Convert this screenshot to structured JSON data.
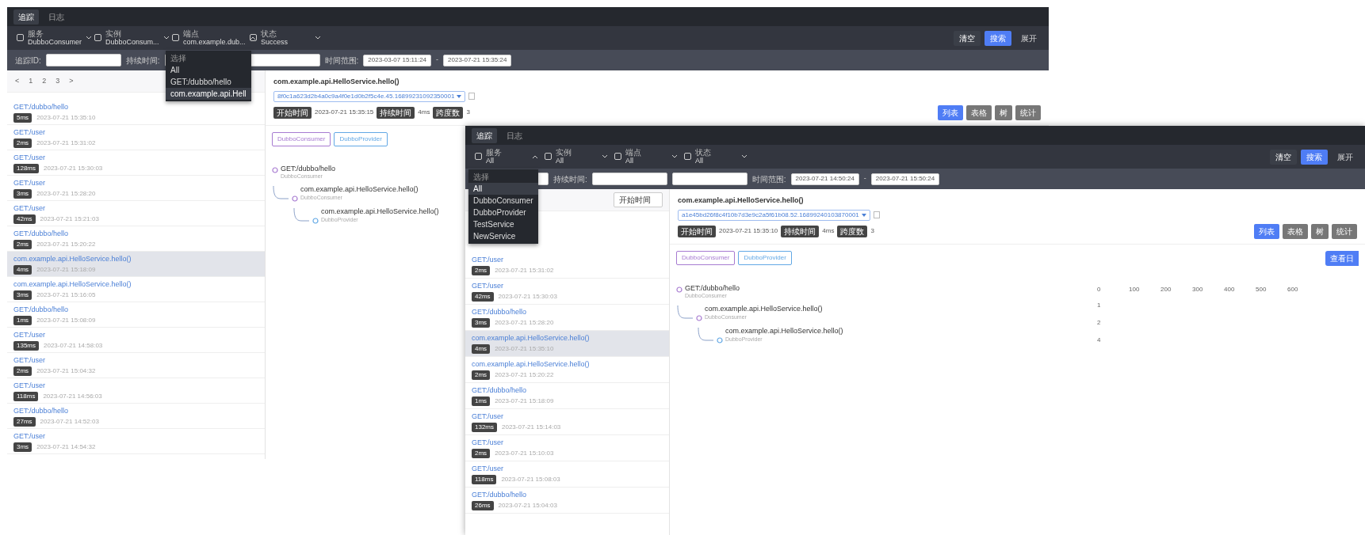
{
  "windows": [
    {
      "kind": "back",
      "tabs": [
        {
          "label": "追踪",
          "selected": true
        },
        {
          "label": "日志",
          "selected": false
        }
      ],
      "filters": [
        {
          "label": "服务",
          "value": "DubboConsumer",
          "open": false
        },
        {
          "label": "实例",
          "value": "DubboConsum...",
          "open": false
        },
        {
          "label": "端点",
          "value": "com.example.dub...",
          "open": true,
          "options": [
            {
              "label": "选择",
              "selected": false
            },
            {
              "label": "All",
              "selected": false
            },
            {
              "label": "GET:/dubbo/hello",
              "selected": false
            },
            {
              "label": "com.example.api.Hell",
              "selected": true
            }
          ]
        },
        {
          "label": "状态",
          "value": "Success",
          "open": false
        }
      ],
      "actions": [
        {
          "label": "清空",
          "kind": "plain"
        },
        {
          "label": "搜索",
          "kind": "primary"
        },
        {
          "label": "展开",
          "kind": "link"
        }
      ],
      "fields": [
        {
          "kind": "labeled",
          "label": "追踪ID:"
        },
        {
          "kind": "labeled",
          "label": "持续时间:"
        },
        {
          "kind": "bare"
        }
      ],
      "time_range": {
        "label": "时间范围:",
        "start": "2023-03-07 15:11:24",
        "separator": "-",
        "end": "2023-07-21 15:35:24"
      },
      "list": {
        "pager": [
          "<",
          "1",
          "2",
          "3",
          ">"
        ],
        "items": [
          {
            "title": "GET:/dubbo/hello",
            "duration": "5ms",
            "time": "2023-07-21 15:35:10",
            "selected": false
          },
          {
            "title": "GET:/user",
            "duration": "2ms",
            "time": "2023-07-21 15:31:02",
            "selected": false
          },
          {
            "title": "GET:/user",
            "duration": "128ms",
            "time": "2023-07-21 15:30:03",
            "selected": false
          },
          {
            "title": "GET:/user",
            "duration": "3ms",
            "time": "2023-07-21 15:28:20",
            "selected": false
          },
          {
            "title": "GET:/user",
            "duration": "42ms",
            "time": "2023-07-21 15:21:03",
            "selected": false
          },
          {
            "title": "GET:/dubbo/hello",
            "duration": "2ms",
            "time": "2023-07-21 15:20:22",
            "selected": false
          },
          {
            "title": "com.example.api.HelloService.hello()",
            "duration": "4ms",
            "time": "2023-07-21 15:18:09",
            "selected": true
          },
          {
            "title": "com.example.api.HelloService.hello()",
            "duration": "3ms",
            "time": "2023-07-21 15:16:05",
            "selected": false
          },
          {
            "title": "GET:/dubbo/hello",
            "duration": "1ms",
            "time": "2023-07-21 15:08:09",
            "selected": false
          },
          {
            "title": "GET:/user",
            "duration": "135ms",
            "time": "2023-07-21 14:58:03",
            "selected": false
          },
          {
            "title": "GET:/user",
            "duration": "2ms",
            "time": "2023-07-21 15:04:32",
            "selected": false
          },
          {
            "title": "GET:/user",
            "duration": "118ms",
            "time": "2023-07-21 14:56:03",
            "selected": false
          },
          {
            "title": "GET:/dubbo/hello",
            "duration": "27ms",
            "time": "2023-07-21 14:52:03",
            "selected": false
          },
          {
            "title": "GET:/user",
            "duration": "3ms",
            "time": "2023-07-21 14:54:32",
            "selected": false
          }
        ]
      },
      "detail": {
        "title": "com.example.api.HelloService.hello()",
        "trace_id": "8f0c1a623d2b4a0c9a4f0e1d0b2f5c4e.45.16899231092350001",
        "meta": [
          {
            "badge": "开始时间",
            "text": "2023-07-21 15:35:15"
          },
          {
            "badge": "持续时间",
            "text": "4ms"
          },
          {
            "badge": "跨度数",
            "text": "3"
          }
        ],
        "views": [
          {
            "label": "列表",
            "selected": true
          },
          {
            "label": "表格",
            "selected": false
          },
          {
            "label": "树",
            "selected": false
          },
          {
            "label": "统计",
            "selected": false
          }
        ],
        "services": [
          {
            "label": "DubboConsumer",
            "color": "#a77bd1"
          },
          {
            "label": "DubboProvider",
            "color": "#62a8e5"
          }
        ],
        "tree": [
          {
            "title": "GET:/dubbo/hello",
            "sub": "DubboConsumer",
            "color": "#a77bd1",
            "children": [
              {
                "title": "com.example.api.HelloService.hello()",
                "sub": "DubboConsumer",
                "color": "#a77bd1",
                "children": [
                  {
                    "title": "com.example.api.HelloService.hello()",
                    "sub": "DubboProvider",
                    "color": "#62a8e5"
                  }
                ]
              }
            ]
          }
        ]
      }
    },
    {
      "kind": "front",
      "tabs": [
        {
          "label": "追踪",
          "selected": true
        },
        {
          "label": "日志",
          "selected": false
        }
      ],
      "filters": [
        {
          "label": "服务",
          "value": "All",
          "open": true,
          "options": [
            {
              "label": "选择",
              "selected": false
            },
            {
              "label": "All",
              "selected": true
            },
            {
              "label": "DubboConsumer",
              "selected": false
            },
            {
              "label": "DubboProvider",
              "selected": false
            },
            {
              "label": "TestService",
              "selected": false
            },
            {
              "label": "NewService",
              "selected": false
            }
          ]
        },
        {
          "label": "实例",
          "value": "All",
          "open": false
        },
        {
          "label": "端点",
          "value": "All",
          "open": false
        },
        {
          "label": "状态",
          "value": "All",
          "open": false
        }
      ],
      "actions": [
        {
          "label": "清空",
          "kind": "plain"
        },
        {
          "label": "搜索",
          "kind": "primary"
        },
        {
          "label": "展开",
          "kind": "link"
        }
      ],
      "fields": [
        {
          "kind": "bare"
        },
        {
          "kind": "labeled",
          "label": "持续时间:"
        },
        {
          "kind": "bare"
        }
      ],
      "time_range": {
        "label": "时间范围:",
        "start": "2023-07-21 14:50:24",
        "separator": "-",
        "end": "2023-07-21 15:50:24"
      },
      "list": {
        "sort": "开始时间",
        "items": [
          {
            "title": "GET:/user",
            "duration": "2ms",
            "time": "2023-07-21 15:31:02",
            "selected": false
          },
          {
            "title": "GET:/user",
            "duration": "42ms",
            "time": "2023-07-21 15:30:03",
            "selected": false
          },
          {
            "title": "GET:/dubbo/hello",
            "duration": "3ms",
            "time": "2023-07-21 15:28:20",
            "selected": false
          },
          {
            "title": "com.example.api.HelloService.hello()",
            "duration": "4ms",
            "time": "2023-07-21 15:35:10",
            "selected": true
          },
          {
            "title": "com.example.api.HelloService.hello()",
            "duration": "2ms",
            "time": "2023-07-21 15:20:22",
            "selected": false
          },
          {
            "title": "GET:/dubbo/hello",
            "duration": "1ms",
            "time": "2023-07-21 15:18:09",
            "selected": false
          },
          {
            "title": "GET:/user",
            "duration": "132ms",
            "time": "2023-07-21 15:14:03",
            "selected": false
          },
          {
            "title": "GET:/user",
            "duration": "2ms",
            "time": "2023-07-21 15:10:03",
            "selected": false
          },
          {
            "title": "GET:/user",
            "duration": "118ms",
            "time": "2023-07-21 15:08:03",
            "selected": false
          },
          {
            "title": "GET:/dubbo/hello",
            "duration": "26ms",
            "time": "2023-07-21 15:04:03",
            "selected": false
          }
        ]
      },
      "detail": {
        "title": "com.example.api.HelloService.hello()",
        "trace_id": "a1e45bd26f8c4f10b7d3e9c2a5f61b08.52.16899240103870001",
        "meta": [
          {
            "badge": "开始时间",
            "text": "2023-07-21 15:35:10"
          },
          {
            "badge": "持续时间",
            "text": "4ms"
          },
          {
            "badge": "跨度数",
            "text": "3"
          }
        ],
        "views": [
          {
            "label": "列表",
            "selected": true
          },
          {
            "label": "表格",
            "selected": false
          },
          {
            "label": "树",
            "selected": false
          },
          {
            "label": "统计",
            "selected": false
          }
        ],
        "log_button": "查看日",
        "services": [
          {
            "label": "DubboConsumer",
            "color": "#a77bd1"
          },
          {
            "label": "DubboProvider",
            "color": "#62a8e5"
          }
        ],
        "ticks": [
          "0",
          "100",
          "200",
          "300",
          "400",
          "500",
          "600"
        ],
        "tree": [
          {
            "title": "GET:/dubbo/hello",
            "sub": "DubboConsumer",
            "color": "#a77bd1",
            "value": "1",
            "children": [
              {
                "title": "com.example.api.HelloService.hello()",
                "sub": "DubboConsumer",
                "color": "#a77bd1",
                "value": "2",
                "children": [
                  {
                    "title": "com.example.api.HelloService.hello()",
                    "sub": "DubboProvider",
                    "color": "#62a8e5",
                    "value": "4"
                  }
                ]
              }
            ]
          }
        ]
      }
    }
  ]
}
